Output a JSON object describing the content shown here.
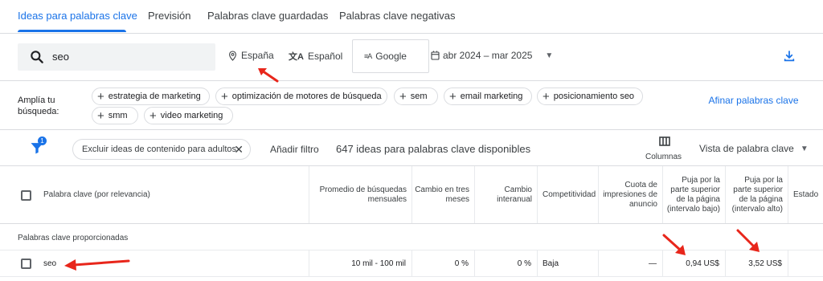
{
  "tabs": [
    {
      "label": "Ideas para palabras clave",
      "active": true
    },
    {
      "label": "Previsión"
    },
    {
      "label": "Palabras clave guardadas"
    },
    {
      "label": "Palabras clave negativas"
    }
  ],
  "search": {
    "value": "seo",
    "icon": "search-icon"
  },
  "location": {
    "label": "España",
    "icon": "location-pin-icon"
  },
  "language": {
    "label": "Español",
    "icon": "translate-icon"
  },
  "network": {
    "label": "Google",
    "icon": "search-network-icon"
  },
  "date_range": {
    "label": "abr 2024 – mar 2025",
    "icon": "calendar-icon"
  },
  "broaden": {
    "label": "Amplía tu búsqueda:",
    "chips": [
      "estrategia de marketing",
      "optimización de motores de búsqueda",
      "sem",
      "email marketing",
      "posicionamiento seo",
      "smm",
      "video marketing"
    ],
    "refine_label": "Afinar palabras clave"
  },
  "filters": {
    "badge_count": "1",
    "adult_chip": "Excluir ideas de contenido para adultos",
    "add_filter": "Añadir filtro",
    "count_text": "647 ideas para palabras clave disponibles",
    "columns_label": "Columnas",
    "view_label": "Vista de palabra clave"
  },
  "table": {
    "headers": [
      "Palabra clave (por relevancia)",
      "Promedio de búsquedas mensuales",
      "Cambio en tres meses",
      "Cambio interanual",
      "Competitividad",
      "Cuota de impresiones de anuncio",
      "Puja por la parte superior de la página (intervalo bajo)",
      "Puja por la parte superior de la página (intervalo alto)",
      "Estado"
    ],
    "group_label": "Palabras clave proporcionadas",
    "rows": [
      {
        "keyword": "seo",
        "avg_monthly": "10 mil - 100 mil",
        "three_month": "0 %",
        "yoy": "0 %",
        "competition": "Baja",
        "impression_share": "—",
        "bid_low": "0,94 US$",
        "bid_high": "3,52 US$"
      }
    ]
  },
  "colors": {
    "accent": "#1a73e8",
    "annotation": "#e8261b"
  }
}
